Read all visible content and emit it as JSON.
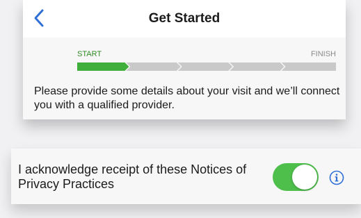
{
  "nav": {
    "title": "Get Started",
    "back_icon": "chevron-left-icon"
  },
  "progress": {
    "start_label": "START",
    "finish_label": "FINISH",
    "total_steps": 5,
    "current_step": 1,
    "active_color": "#3fae3b",
    "inactive_color": "#c9c9c9"
  },
  "intro": {
    "text": "Please provide some details about your visit and we’ll connect you with a qualified provider."
  },
  "acknowledgement": {
    "text": "I acknowledge receipt of these Notices of Privacy Practices",
    "toggle_on": true,
    "toggle_color": "#4fbf4c",
    "info_icon": "info-icon"
  },
  "colors": {
    "accent": "#2f6fd6"
  }
}
